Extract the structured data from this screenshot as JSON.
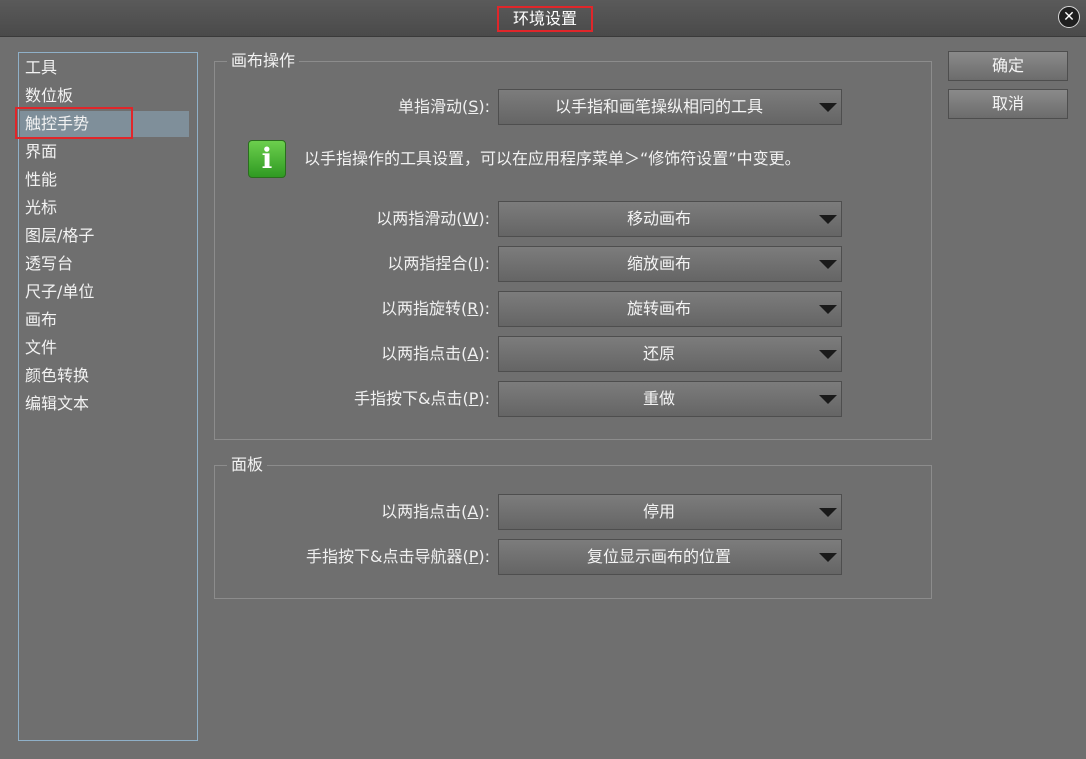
{
  "window": {
    "title": "环境设置",
    "close_label": "✕"
  },
  "sidebar": {
    "items": [
      {
        "label": "工具"
      },
      {
        "label": "数位板"
      },
      {
        "label": "触控手势"
      },
      {
        "label": "界面"
      },
      {
        "label": "性能"
      },
      {
        "label": "光标"
      },
      {
        "label": "图层/格子"
      },
      {
        "label": "透写台"
      },
      {
        "label": "尺子/单位"
      },
      {
        "label": "画布"
      },
      {
        "label": "文件"
      },
      {
        "label": "颜色转换"
      },
      {
        "label": "编辑文本"
      }
    ],
    "selected_index": 2
  },
  "canvas_group": {
    "title": "画布操作",
    "single_swipe": {
      "label": "单指滑动(",
      "key": "S",
      "suffix": "):",
      "value": "以手指和画笔操纵相同的工具"
    },
    "info": {
      "icon": "info-icon",
      "glyph": "i",
      "text": "以手指操作的工具设置，可以在应用程序菜单＞“修饰符设置”中变更。"
    },
    "rows": [
      {
        "label": "以两指滑动(",
        "key": "W",
        "suffix": "):",
        "value": "移动画布"
      },
      {
        "label": "以两指捏合(",
        "key": "I",
        "suffix": "):",
        "value": "缩放画布"
      },
      {
        "label": "以两指旋转(",
        "key": "R",
        "suffix": "):",
        "value": "旋转画布"
      },
      {
        "label": "以两指点击(",
        "key": "A",
        "suffix": "):",
        "value": "还原"
      },
      {
        "label": "手指按下&点击(",
        "key": "P",
        "suffix": "):",
        "value": "重做"
      }
    ]
  },
  "panel_group": {
    "title": "面板",
    "rows": [
      {
        "label": "以两指点击(",
        "key": "A",
        "suffix": "):",
        "value": "停用"
      },
      {
        "label": "手指按下&点击导航器(",
        "key": "P",
        "suffix": "):",
        "value": "复位显示画布的位置"
      }
    ]
  },
  "buttons": {
    "ok": "确定",
    "cancel": "取消"
  },
  "colors": {
    "highlight": "#e0262a",
    "info_green": "#3fae2b"
  }
}
